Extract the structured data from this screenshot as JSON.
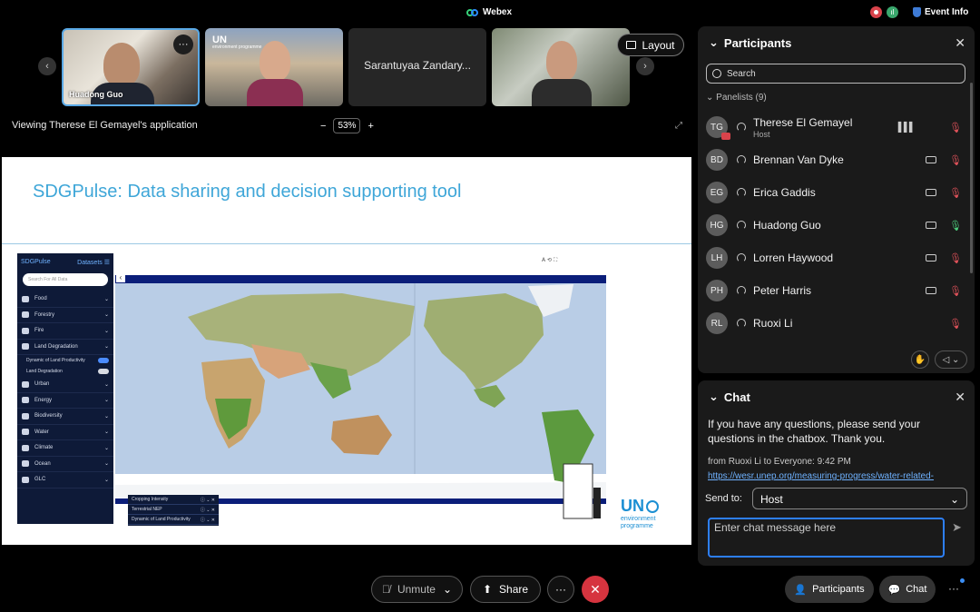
{
  "titlebar": {
    "app_title": "Webex",
    "event_info": "Event Info"
  },
  "video_strip": {
    "tiles": [
      {
        "name": "Huadong Guo"
      },
      {
        "name": "",
        "logo_text": "UN",
        "logo_sub": "environment programme"
      },
      {
        "name": "Sarantuyaa Zandary..."
      },
      {
        "name": ""
      }
    ],
    "layout_label": "Layout",
    "menu_glyph": "···"
  },
  "share_bar": {
    "viewing_text": "Viewing Therese El Gemayel's application",
    "zoom_minus": "−",
    "zoom_value": "53%",
    "zoom_plus": "+"
  },
  "slide": {
    "title": "SDGPulse: Data sharing and decision supporting tool",
    "sdg_app": {
      "brand": "SDGPulse",
      "datasets_label": "Datasets",
      "search_placeholder": "Search For All Data",
      "categories": [
        {
          "label": "Food"
        },
        {
          "label": "Forestry"
        },
        {
          "label": "Fire"
        },
        {
          "label": "Land Degradation"
        }
      ],
      "sub_items": [
        {
          "label": "Dynamic of Land Productivity",
          "on": true
        },
        {
          "label": "Land Degradation",
          "on": false
        }
      ],
      "categories_after": [
        {
          "label": "Urban"
        },
        {
          "label": "Energy"
        },
        {
          "label": "Biodiversity"
        },
        {
          "label": "Water"
        },
        {
          "label": "Climate"
        },
        {
          "label": "Ocean"
        },
        {
          "label": "GLC"
        }
      ],
      "legend": [
        "Cropping Intensity",
        "Terrestrial NEP",
        "Dynamic of Land Productivity"
      ]
    },
    "logo": {
      "text": "UN",
      "line1": "environment",
      "line2": "programme"
    }
  },
  "participants": {
    "title": "Participants",
    "search_placeholder": "Search",
    "section_label": "Panelists (9)",
    "rows": [
      {
        "initials": "TG",
        "name": "Therese El Gemayel",
        "role": "Host",
        "video": false,
        "mic": "muted",
        "speaking": true
      },
      {
        "initials": "BD",
        "name": "Brennan Van Dyke",
        "role": "",
        "video": true,
        "mic": "muted"
      },
      {
        "initials": "EG",
        "name": "Erica Gaddis",
        "role": "",
        "video": true,
        "mic": "muted"
      },
      {
        "initials": "HG",
        "name": "Huadong Guo",
        "role": "",
        "video": true,
        "mic": "live"
      },
      {
        "initials": "LH",
        "name": "Lorren Haywood",
        "role": "",
        "video": true,
        "mic": "muted"
      },
      {
        "initials": "PH",
        "name": "Peter Harris",
        "role": "",
        "video": true,
        "mic": "muted"
      },
      {
        "initials": "RL",
        "name": "Ruoxi Li",
        "role": "",
        "video": false,
        "mic": "muted"
      }
    ]
  },
  "chat": {
    "title": "Chat",
    "message": "If you have any questions, please send your questions in the chatbox. Thank you.",
    "from_line": "from Ruoxi Li to Everyone:   9:42  PM",
    "link": "https://wesr.unep.org/measuring-progress/water-related-",
    "send_to_label": "Send to:",
    "send_to_value": "Host",
    "input_placeholder": "Enter chat message here"
  },
  "controls": {
    "unmute": "Unmute",
    "share": "Share",
    "more": "···",
    "participants": "Participants",
    "chat": "Chat",
    "overflow": "···"
  },
  "colors": {
    "accent": "#2d7ff9",
    "end_call": "#d6343f",
    "slide_title": "#3ea6d8",
    "muted": "#e0525a",
    "live_mic": "#4dcf7d"
  }
}
